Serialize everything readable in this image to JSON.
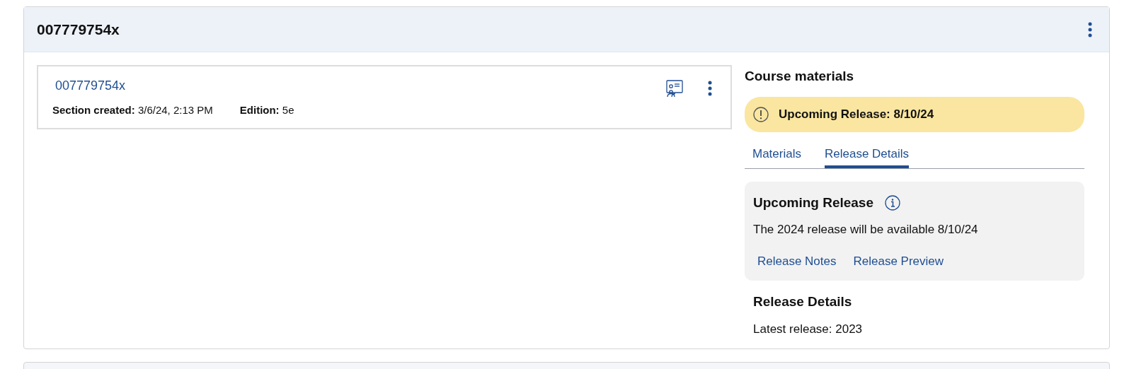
{
  "card": {
    "title": "007779754x"
  },
  "section": {
    "link": "007779754x",
    "meta": [
      "**Section created:** 3/6/24, 2:13 PM",
      "**Edition:** 5e"
    ]
  },
  "materials": {
    "heading": "Course materials",
    "alert": "Upcoming Release: 8/10/24",
    "tabs": [
      {
        "label": "Materials",
        "selected": false
      },
      {
        "label": "Release Details",
        "selected": true
      }
    ],
    "upcoming": {
      "heading": "Upcoming Release",
      "text": "The 2024 release will be available 8/10/24",
      "links": [
        "Release Notes",
        "Release Preview"
      ]
    },
    "details": {
      "heading": "Release Details",
      "text": "Latest release: 2023"
    }
  }
}
